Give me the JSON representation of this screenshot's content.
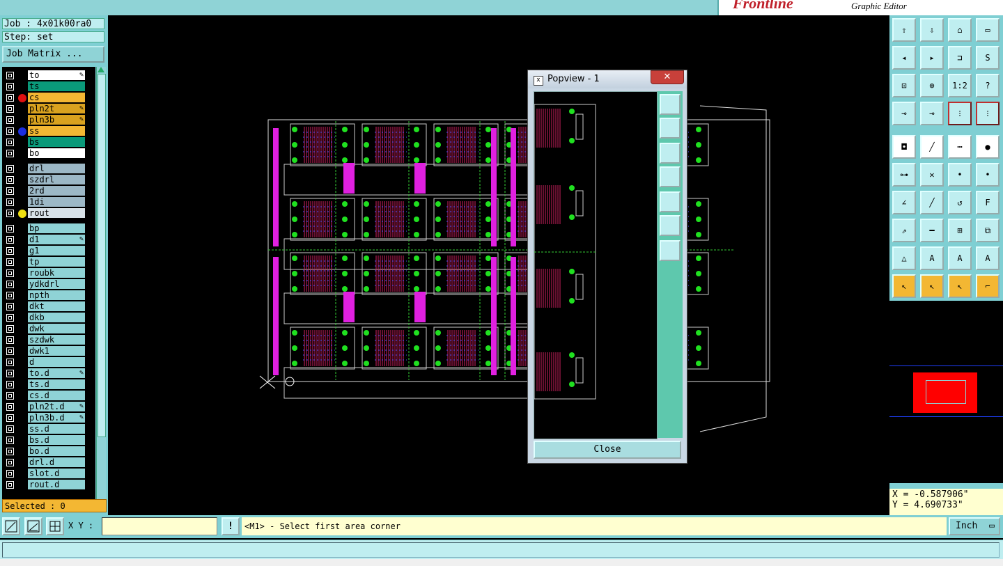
{
  "header": {
    "brand": "Frontline",
    "subtitle": "Graphic Editor"
  },
  "left": {
    "job": "Job : 4x01k00ra0",
    "step": "Step: set",
    "job_matrix": "Job Matrix ...",
    "selected": "Selected : 0",
    "layers": [
      {
        "name": "to",
        "color": "#ffffff",
        "dot": "",
        "pen": true
      },
      {
        "name": "ts",
        "color": "#0a9a7a",
        "dot": "",
        "pen": false
      },
      {
        "name": "cs",
        "color": "#f3b733",
        "dot": "#e01010",
        "pen": false
      },
      {
        "name": "pln2t",
        "color": "#d9a21f",
        "dot": "",
        "pen": true
      },
      {
        "name": "pln3b",
        "color": "#d9a21f",
        "dot": "",
        "pen": true
      },
      {
        "name": "ss",
        "color": "#f3b733",
        "dot": "#1c2ee0",
        "pen": false
      },
      {
        "name": "bs",
        "color": "#0a9a7a",
        "dot": "",
        "pen": false
      },
      {
        "name": "bo",
        "color": "#ffffff",
        "dot": "",
        "pen": false
      },
      {
        "name": "drl",
        "color": "#9cb8c6",
        "dot": "",
        "pen": false
      },
      {
        "name": "szdrl",
        "color": "#9cb8c6",
        "dot": "",
        "pen": false
      },
      {
        "name": "2rd",
        "color": "#9cb8c6",
        "dot": "",
        "pen": false
      },
      {
        "name": "1di",
        "color": "#9cb8c6",
        "dot": "",
        "pen": false
      },
      {
        "name": "rout",
        "color": "#d8e2e8",
        "dot": "#f0e010",
        "pen": false
      },
      {
        "name": "bp",
        "color": "#8fd3d6",
        "dot": "",
        "pen": false
      },
      {
        "name": "d1",
        "color": "#8fd3d6",
        "dot": "",
        "pen": true
      },
      {
        "name": "g1",
        "color": "#8fd3d6",
        "dot": "",
        "pen": false
      },
      {
        "name": "tp",
        "color": "#8fd3d6",
        "dot": "",
        "pen": false
      },
      {
        "name": "roubk",
        "color": "#8fd3d6",
        "dot": "",
        "pen": false
      },
      {
        "name": "ydkdrl",
        "color": "#8fd3d6",
        "dot": "",
        "pen": false
      },
      {
        "name": "npth",
        "color": "#8fd3d6",
        "dot": "",
        "pen": false
      },
      {
        "name": "dkt",
        "color": "#8fd3d6",
        "dot": "",
        "pen": false
      },
      {
        "name": "dkb",
        "color": "#8fd3d6",
        "dot": "",
        "pen": false
      },
      {
        "name": "dwk",
        "color": "#8fd3d6",
        "dot": "",
        "pen": false
      },
      {
        "name": "szdwk",
        "color": "#8fd3d6",
        "dot": "",
        "pen": false
      },
      {
        "name": "dwk1",
        "color": "#8fd3d6",
        "dot": "",
        "pen": false
      },
      {
        "name": "d",
        "color": "#8fd3d6",
        "dot": "",
        "pen": false
      },
      {
        "name": "to.d",
        "color": "#8fd3d6",
        "dot": "",
        "pen": true
      },
      {
        "name": "ts.d",
        "color": "#8fd3d6",
        "dot": "",
        "pen": false
      },
      {
        "name": "cs.d",
        "color": "#8fd3d6",
        "dot": "",
        "pen": false
      },
      {
        "name": "pln2t.d",
        "color": "#8fd3d6",
        "dot": "",
        "pen": true
      },
      {
        "name": "pln3b.d",
        "color": "#8fd3d6",
        "dot": "",
        "pen": true
      },
      {
        "name": "ss.d",
        "color": "#8fd3d6",
        "dot": "",
        "pen": false
      },
      {
        "name": "bs.d",
        "color": "#8fd3d6",
        "dot": "",
        "pen": false
      },
      {
        "name": "bo.d",
        "color": "#8fd3d6",
        "dot": "",
        "pen": false
      },
      {
        "name": "drl.d",
        "color": "#8fd3d6",
        "dot": "",
        "pen": false
      },
      {
        "name": "slot.d",
        "color": "#8fd3d6",
        "dot": "",
        "pen": false
      },
      {
        "name": "rout.d",
        "color": "#8fd3d6",
        "dot": "",
        "pen": false
      }
    ]
  },
  "right": {
    "x_coord": "X = -0.587906\"",
    "y_coord": "Y = 4.690733\"",
    "toolbar_icons": [
      "zoom-home-icon",
      "page-down-icon",
      "house-icon",
      "window-icon",
      "pan-left-icon",
      "pan-right-icon",
      "split-icon",
      "redraw-icon",
      "zoom-fit-icon",
      "zoom-center-icon",
      "scale-1-2-icon",
      "help-icon",
      "measure-icon",
      "snap-icon",
      "layer-red-icon",
      "layer-red2-icon",
      "pad-icon",
      "line-icon",
      "ruler-icon",
      "circle-icon",
      "connect-icon",
      "cross-icon",
      "node-icon",
      "node2-icon",
      "angle-icon",
      "slash-icon",
      "rotate-icon",
      "flip-icon",
      "move-icon",
      "minus-icon",
      "resize-icon",
      "group-icon",
      "triangle-icon",
      "text-a-icon",
      "arc-a-icon",
      "arc-b-icon",
      "arrow-icon",
      "select-icon",
      "select2-icon",
      "route-icon"
    ]
  },
  "bottom": {
    "xy_label": "X Y :",
    "xy_value": "",
    "prompt": "<M1> - Select first area corner",
    "units": "Inch"
  },
  "popview": {
    "title": "Popview - 1",
    "close_label": "Close"
  }
}
